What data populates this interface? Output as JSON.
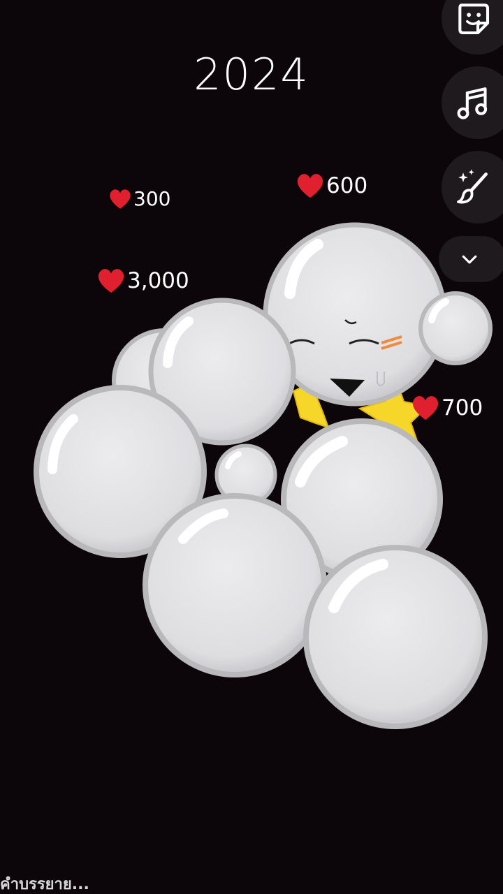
{
  "header": {
    "year": "2024"
  },
  "likes": [
    {
      "count": "300"
    },
    {
      "count": "600"
    },
    {
      "count": "3,000"
    },
    {
      "count": "700"
    }
  ],
  "toolbar": {
    "items": [
      {
        "icon": "sticker-icon"
      },
      {
        "icon": "music-note-icon"
      },
      {
        "icon": "effects-brush-icon"
      },
      {
        "icon": "chevron-down-icon"
      }
    ]
  },
  "caption": {
    "placeholder": "คำบรรยาย..."
  },
  "colors": {
    "background": "#0c060a",
    "bubble": "#e3e2e4",
    "bubble_edge": "#b9b8bb",
    "heart": "#e0202e",
    "star": "#f7d62a",
    "blush": "#f08a3c"
  }
}
